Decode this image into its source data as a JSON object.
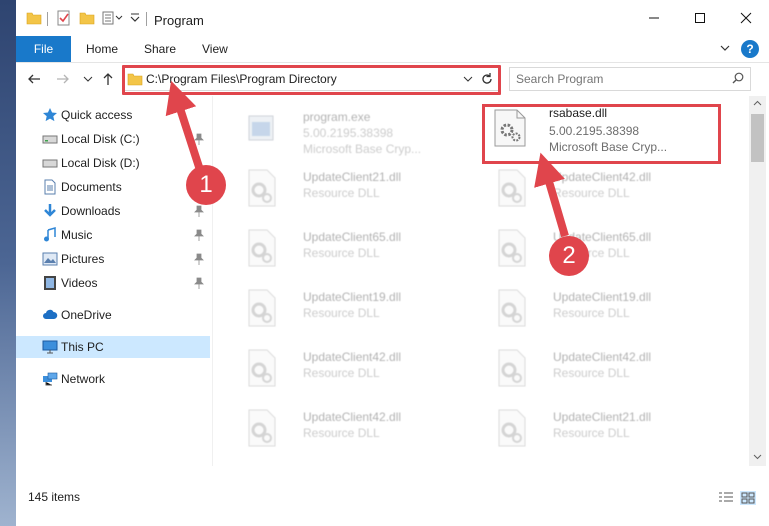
{
  "window": {
    "title": "Program",
    "min_label": "Minimize",
    "max_label": "Maximize",
    "close_label": "Close"
  },
  "ribbon": {
    "tabs": [
      "File",
      "Home",
      "Share",
      "View"
    ],
    "help": "?"
  },
  "address": {
    "path": "C:\\Program Files\\Program Directory",
    "search_placeholder": "Search Program"
  },
  "nav": {
    "items": [
      {
        "label": "Quick access",
        "icon": "star-icon",
        "pinned": false
      },
      {
        "label": "Local Disk (C:)",
        "icon": "drive-icon",
        "pinned": true
      },
      {
        "label": "Local Disk (D:)",
        "icon": "drive-icon",
        "pinned": false
      },
      {
        "label": "Documents",
        "icon": "documents-icon",
        "pinned": true
      },
      {
        "label": "Downloads",
        "icon": "download-icon",
        "pinned": true
      },
      {
        "label": "Music",
        "icon": "music-icon",
        "pinned": true
      },
      {
        "label": "Pictures",
        "icon": "pictures-icon",
        "pinned": true
      },
      {
        "label": "Videos",
        "icon": "videos-icon",
        "pinned": true
      },
      {
        "label": "OneDrive",
        "icon": "cloud-icon",
        "pinned": false
      },
      {
        "label": "This PC",
        "icon": "computer-icon",
        "pinned": false,
        "selected": true
      },
      {
        "label": "Network",
        "icon": "network-icon",
        "pinned": false
      }
    ]
  },
  "files": [
    {
      "name": "program.exe",
      "line1": "5.00.2195.38398",
      "line2": "Microsoft Base Cryp...",
      "icon": "exe-icon",
      "faded": true
    },
    {
      "name": "rsabase.dll",
      "line1": "5.00.2195.38398",
      "line2": "Microsoft Base Cryp...",
      "icon": "dll-gear-icon",
      "faded": false,
      "highlighted": true
    },
    {
      "name": "UpdateClient21.dll",
      "line1": "Resource DLL",
      "line2": "",
      "icon": "dll-gear-icon",
      "faded": true
    },
    {
      "name": "UpdateClient42.dll",
      "line1": "Resource DLL",
      "line2": "",
      "icon": "dll-gear-icon",
      "faded": true
    },
    {
      "name": "UpdateClient65.dll",
      "line1": "Resource DLL",
      "line2": "",
      "icon": "dll-gear-icon",
      "faded": true
    },
    {
      "name": "UpdateClient65.dll",
      "line1": "Resource DLL",
      "line2": "",
      "icon": "dll-gear-icon",
      "faded": true
    },
    {
      "name": "UpdateClient19.dll",
      "line1": "Resource DLL",
      "line2": "",
      "icon": "dll-gear-icon",
      "faded": true
    },
    {
      "name": "UpdateClient19.dll",
      "line1": "Resource DLL",
      "line2": "",
      "icon": "dll-gear-icon",
      "faded": true
    },
    {
      "name": "UpdateClient42.dll",
      "line1": "Resource DLL",
      "line2": "",
      "icon": "dll-gear-icon",
      "faded": true
    },
    {
      "name": "UpdateClient42.dll",
      "line1": "Resource DLL",
      "line2": "",
      "icon": "dll-gear-icon",
      "faded": true
    },
    {
      "name": "UpdateClient42.dll",
      "line1": "Resource DLL",
      "line2": "",
      "icon": "dll-gear-icon",
      "faded": true
    },
    {
      "name": "UpdateClient21.dll",
      "line1": "Resource DLL",
      "line2": "",
      "icon": "dll-gear-icon",
      "faded": true
    }
  ],
  "status": {
    "items": "145 items"
  },
  "annotations": {
    "callout1": "1",
    "callout2": "2",
    "color": "#e0454c"
  },
  "colors": {
    "accent": "#1979ca",
    "selection": "#cce8ff"
  }
}
